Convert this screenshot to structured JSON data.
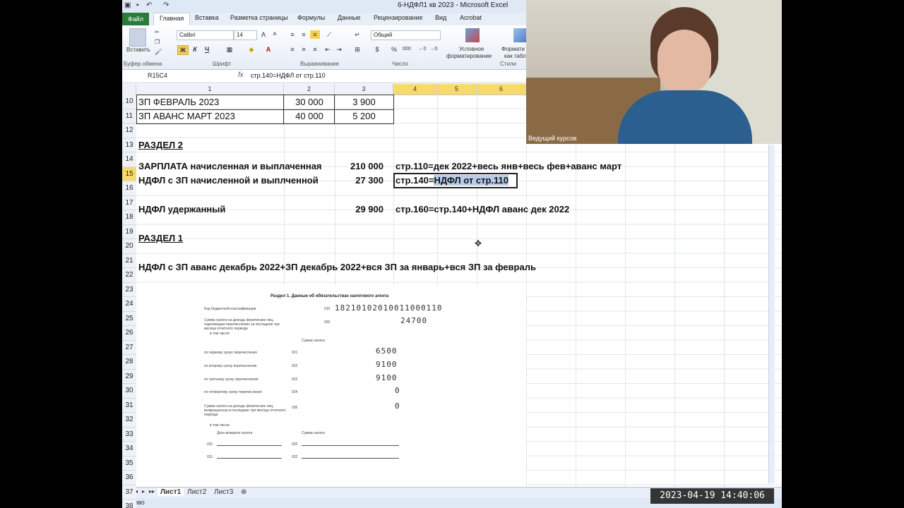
{
  "window": {
    "title": "6-НДФЛ1 кв 2023 - Microsoft Excel"
  },
  "ribbon_tabs": [
    "Файл",
    "Главная",
    "Вставка",
    "Разметка страницы",
    "Формулы",
    "Данные",
    "Рецензирование",
    "Вид",
    "Acrobat"
  ],
  "ribbon": {
    "paste": "Вставить",
    "font_name": "Calibri",
    "font_size": "14",
    "number_format": "Общий",
    "conditional_1": "Условное",
    "conditional_2": "форматирование",
    "format_table_1": "Формати",
    "format_table_2": "как табл",
    "bold_label": "Ж",
    "italic_label": "К",
    "underline_label": "Ч",
    "percent": "%",
    "thousands": "000",
    "groups": {
      "clipboard": "Буфер обмена",
      "font": "Шрифт",
      "alignment": "Выравнивание",
      "number": "Число",
      "styles": "Стили"
    }
  },
  "formula_bar": {
    "name_box": "R15C4",
    "fx": "fx",
    "formula": "стр.140=НДФЛ от стр.110"
  },
  "columns": [
    "1",
    "2",
    "3",
    "4",
    "5",
    "6"
  ],
  "rows_visible": [
    "10",
    "11",
    "12",
    "13",
    "14",
    "15",
    "16",
    "17",
    "18",
    "19",
    "20",
    "21",
    "22",
    "23",
    "24",
    "25",
    "26",
    "27",
    "28",
    "29",
    "30",
    "31",
    "32",
    "33",
    "34",
    "35",
    "36",
    "37",
    "38"
  ],
  "cells": {
    "r10c1": "ЗП ФЕВРАЛЬ 2023",
    "r10c2": "30 000",
    "r10c3": "3 900",
    "r11c1": "ЗП АВАНС МАРТ 2023",
    "r11c2": "40 000",
    "r11c3": "5 200",
    "r13c1": "РАЗДЕЛ  2",
    "r14c1": "ЗАРПЛАТА начисленная и выплаченная",
    "r14c3": "210 000",
    "r14c4": "стр.110=дек 2022+весь янв+весь фев+аванс март",
    "r15c1": "НДФЛ с ЗП начисленной и выплченной",
    "r15c3": "27 300",
    "r15c4_a": "стр.140=",
    "r15c4_b": "НДФЛ от стр.110",
    "r17c1": "НДФЛ удержанный",
    "r17c3": "29 900",
    "r17c4": "стр.160=стр.140+НДФЛ аванс дек 2022",
    "r19c1": "РАЗДЕЛ 1",
    "r21c1": "НДФЛ с ЗП аванс декабрь 2022+ЗП декабрь 2022+вся ЗП за январь+вся ЗП за февраль"
  },
  "form_image": {
    "title": "Раздел 1. Данные об обязательствах налогового агента",
    "kbk_label": "Код бюджетной классификации",
    "kbk_code": "010",
    "kbk_value": "18210102010011000110",
    "sum_label": "Сумма налога на доходы физических лиц, подлежащая перечислению за последние три месяца отчетного периода",
    "sum_code": "020",
    "sum_value": "24700",
    "incl": "в том числе:",
    "tax_sum_header": "Сумма налога",
    "rows": [
      {
        "label": "по первому сроку перечисления",
        "code": "021",
        "value": "6500"
      },
      {
        "label": "по второму сроку перечисления",
        "code": "022",
        "value": "9100"
      },
      {
        "label": "по третьему сроку перечисления",
        "code": "023",
        "value": "9100"
      },
      {
        "label": "по четвертому сроку перечисления",
        "code": "024",
        "value": "0"
      }
    ],
    "returned_label": "Сумма налога на доходы физических лиц, возвращенная в последние три месяца отчетного периода",
    "returned_code": "030",
    "returned_value": "0",
    "incl2": "в том числе:",
    "return_date_header": "Дата возврата налога",
    "return_sum_header": "Сумма налога",
    "code_031": "031",
    "code_032": "032"
  },
  "sheet_tabs": [
    "Лист1",
    "Лист2",
    "Лист3"
  ],
  "status": "Готово",
  "webcam": {
    "label": "Ведущий курсов"
  },
  "timestamp": "2023-04-19  14:40:06"
}
